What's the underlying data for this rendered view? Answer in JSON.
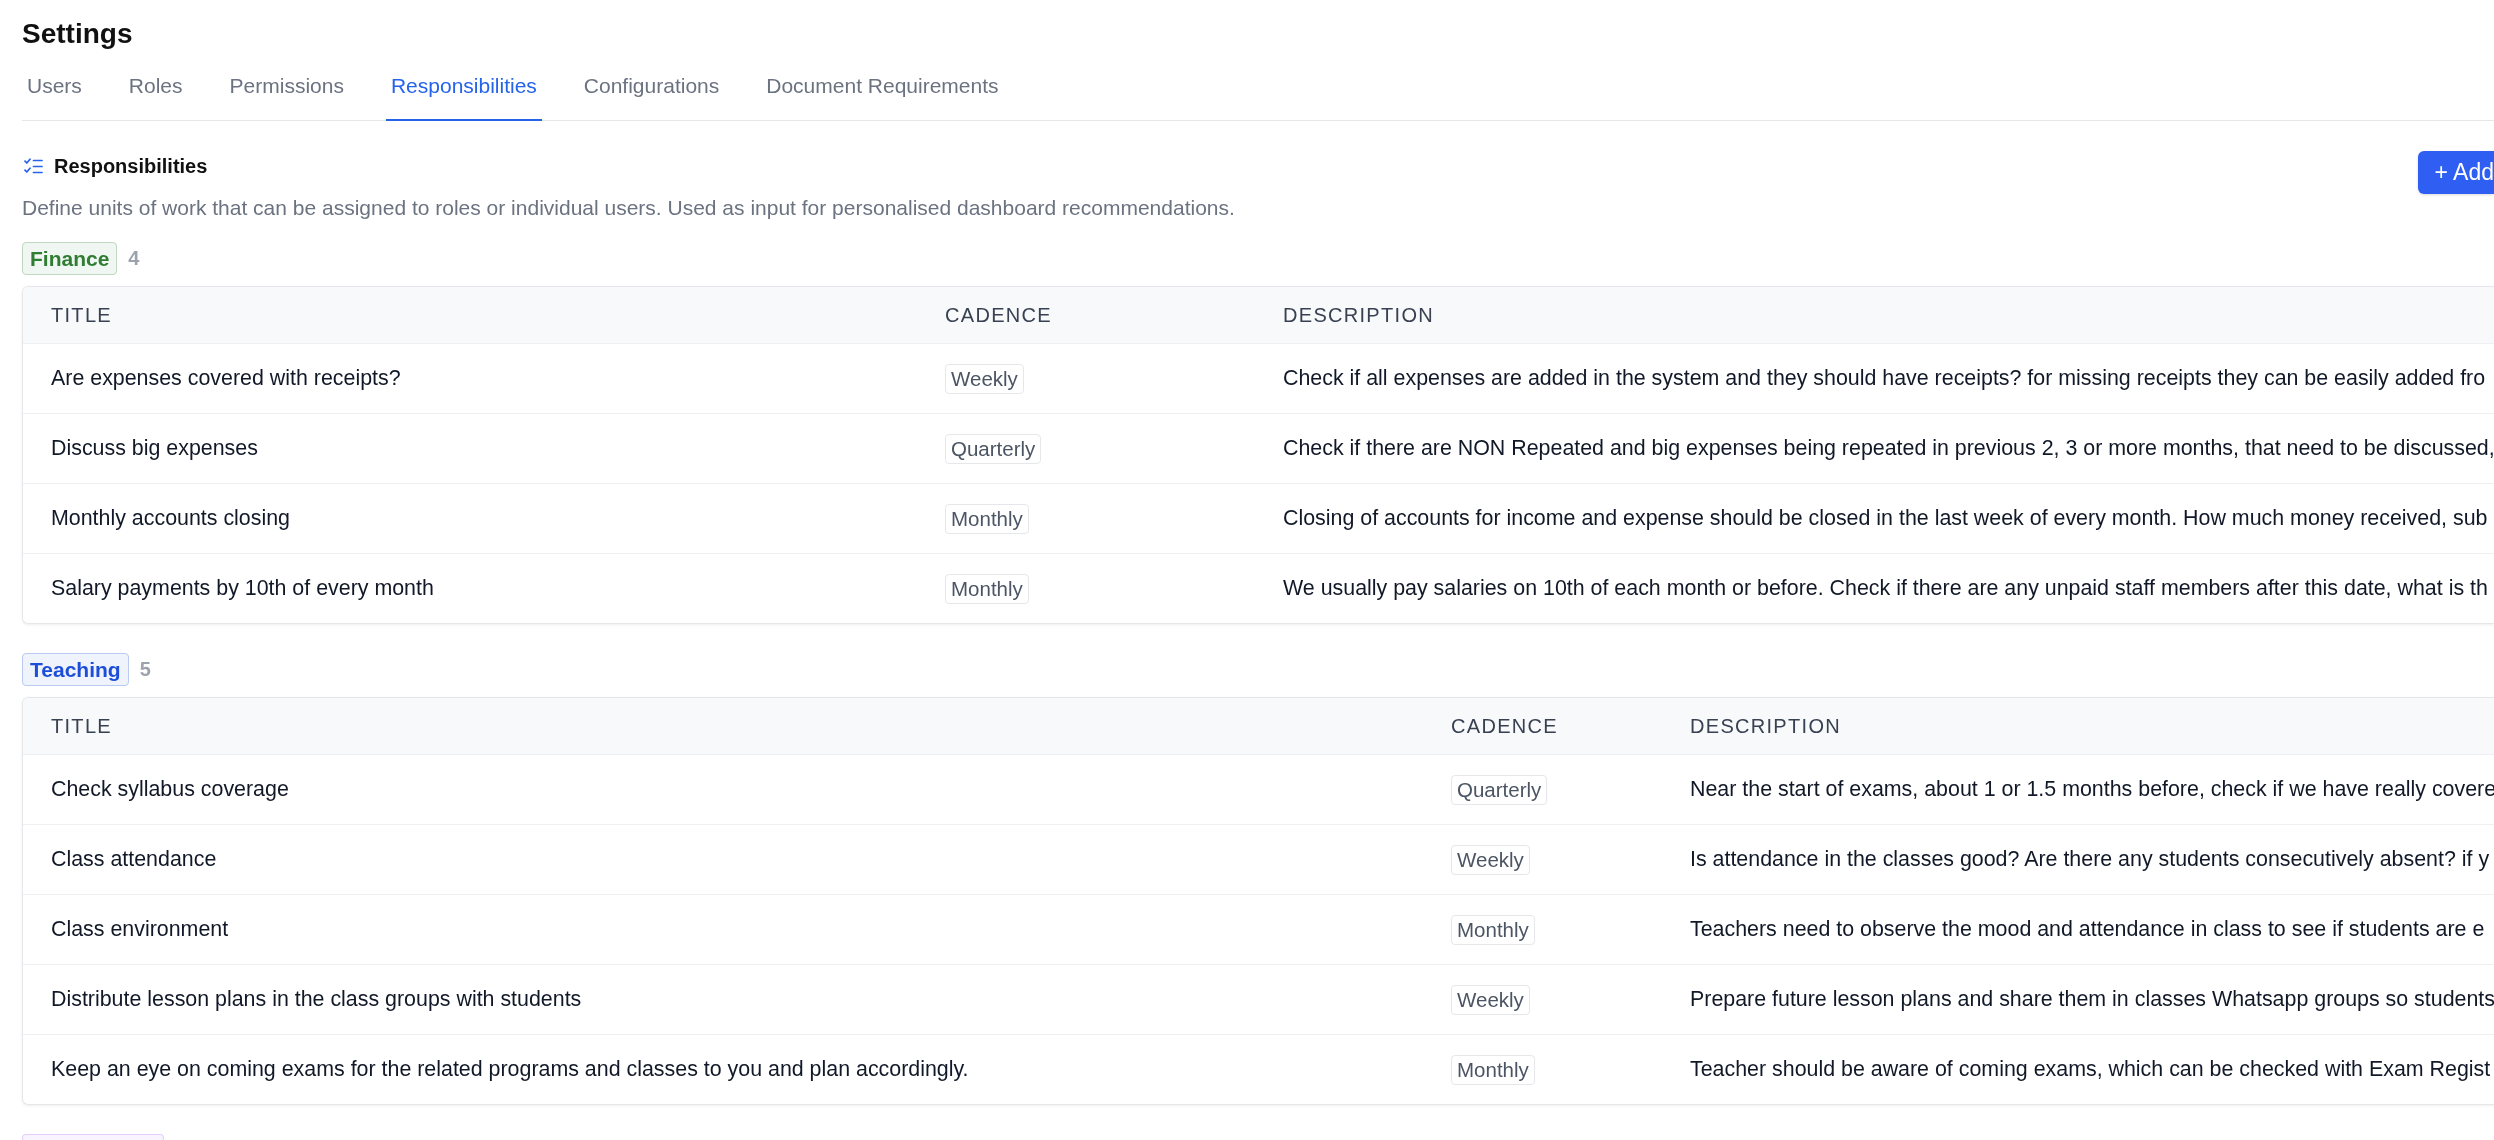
{
  "page": {
    "title": "Settings"
  },
  "tabs": [
    {
      "label": "Users",
      "selected": false
    },
    {
      "label": "Roles",
      "selected": false
    },
    {
      "label": "Permissions",
      "selected": false
    },
    {
      "label": "Responsibilities",
      "selected": true
    },
    {
      "label": "Configurations",
      "selected": false
    },
    {
      "label": "Document Requirements",
      "selected": false
    }
  ],
  "section": {
    "title": "Responsibilities",
    "description": "Define units of work that can be assigned to roles or individual users. Used as input for personalised dashboard recommendations.",
    "add_button": "+ Add"
  },
  "groups": [
    {
      "name": "Finance",
      "count": "4",
      "color": "#2e7d32",
      "table": {
        "columns": [
          "TITLE",
          "CADENCE",
          "DESCRIPTION"
        ],
        "rows": [
          {
            "title": "Are expenses covered with receipts?",
            "cadence": "Weekly",
            "description": "Check if all expenses are added in the system and they should have receipts? for missing receipts they can be easily added fro"
          },
          {
            "title": "Discuss big expenses",
            "cadence": "Quarterly",
            "description": "Check if there are NON Repeated and big expenses being repeated in previous 2, 3 or more months, that need to be discussed,"
          },
          {
            "title": "Monthly accounts closing",
            "cadence": "Monthly",
            "description": "Closing of accounts for income and expense should be closed in the last week of every month. How much money received, sub"
          },
          {
            "title": "Salary payments by 10th of every month",
            "cadence": "Monthly",
            "description": "We usually pay salaries on 10th of each month or before. Check if there are any unpaid staff members after this date, what is th"
          }
        ]
      }
    },
    {
      "name": "Teaching",
      "count": "5",
      "color": "#1d4ed8",
      "table": {
        "columns": [
          "TITLE",
          "CADENCE",
          "DESCRIPTION"
        ],
        "rows": [
          {
            "title": "Check syllabus coverage",
            "cadence": "Quarterly",
            "description": "Near the start of exams, about 1 or 1.5 months before, check if we have really covere"
          },
          {
            "title": "Class attendance",
            "cadence": "Weekly",
            "description": "Is attendance in the classes good? Are there any students consecutively absent? if y"
          },
          {
            "title": "Class environment",
            "cadence": "Monthly",
            "description": "Teachers need to observe the mood and attendance in class to see if students are e"
          },
          {
            "title": "Distribute lesson plans in the class groups with students",
            "cadence": "Weekly",
            "description": "Prepare future lesson plans and share them in classes Whatsapp groups so students"
          },
          {
            "title": "Keep an eye on coming exams for the related programs and classes to you and plan accordingly.",
            "cadence": "Monthly",
            "description": "Teacher should be aware of coming exams, which can be checked with Exam Regist"
          }
        ]
      }
    },
    {
      "color": "#e4cffc"
    }
  ]
}
